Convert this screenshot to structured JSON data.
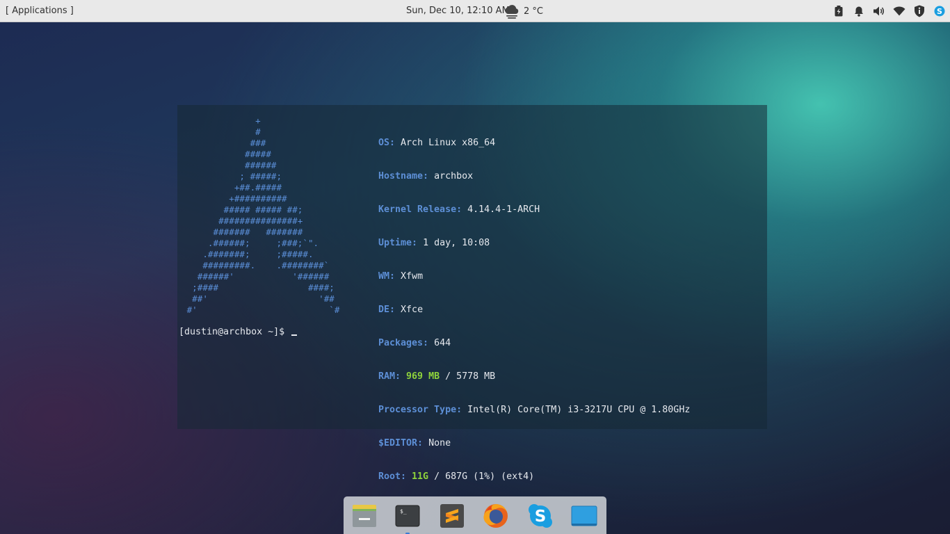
{
  "top_panel": {
    "apps_menu_label": "[ Applications ]",
    "clock": "Sun, Dec 10, 12:10 AM",
    "weather": {
      "icon": "cloud-icon",
      "temperature": "2 °C"
    },
    "tray_icons": [
      "battery-icon",
      "notification-bell-icon",
      "volume-icon",
      "wifi-icon",
      "updates-shield-icon",
      "skype-tray-icon"
    ]
  },
  "terminal": {
    "ascii_art": "              +\n              #\n             ###\n            #####\n            ######\n           ; #####;\n          +##.#####\n         +##########\n        ##### ##### ##;\n       ###############+\n      #######   #######\n     .######;     ;###;`\".\n    .#######;     ;#####.\n    #########.    .########`\n   ######'           '######\n  ;####                 ####;\n  ##'                     '##\n #'                         `#",
    "sysinfo": [
      {
        "key": "OS:",
        "value": "Arch Linux x86_64"
      },
      {
        "key": "Hostname:",
        "value": "archbox"
      },
      {
        "key": "Kernel Release:",
        "value": "4.14.4-1-ARCH"
      },
      {
        "key": "Uptime:",
        "value": "1 day, 10:08"
      },
      {
        "key": "WM:",
        "value": "Xfwm"
      },
      {
        "key": "DE:",
        "value": "Xfce"
      },
      {
        "key": "Packages:",
        "value": "644"
      },
      {
        "key": "RAM:",
        "highlight": "969 MB",
        "value": "/ 5778 MB"
      },
      {
        "key": "Processor Type:",
        "value": "Intel(R) Core(TM) i3-3217U CPU @ 1.80GHz"
      },
      {
        "key": "$EDITOR:",
        "value": "None"
      },
      {
        "key": "Root:",
        "highlight": "11G",
        "value": "/ 687G (1%) (ext4)"
      }
    ],
    "prompt": "[dustin@archbox ~]$"
  },
  "dock": {
    "items": [
      {
        "name": "file-manager-icon",
        "active": false
      },
      {
        "name": "terminal-icon",
        "active": true
      },
      {
        "name": "sublime-text-icon",
        "active": false
      },
      {
        "name": "firefox-icon",
        "active": false
      },
      {
        "name": "skype-icon",
        "active": false
      },
      {
        "name": "desktop-icon",
        "active": false
      }
    ]
  },
  "colors": {
    "panel_bg": "#e9e9e9",
    "terminal_key": "#5d8fd6",
    "terminal_highlight": "#8fd43b",
    "ascii_art": "#5b8fd8",
    "terminal_text": "#e6e9ee"
  }
}
